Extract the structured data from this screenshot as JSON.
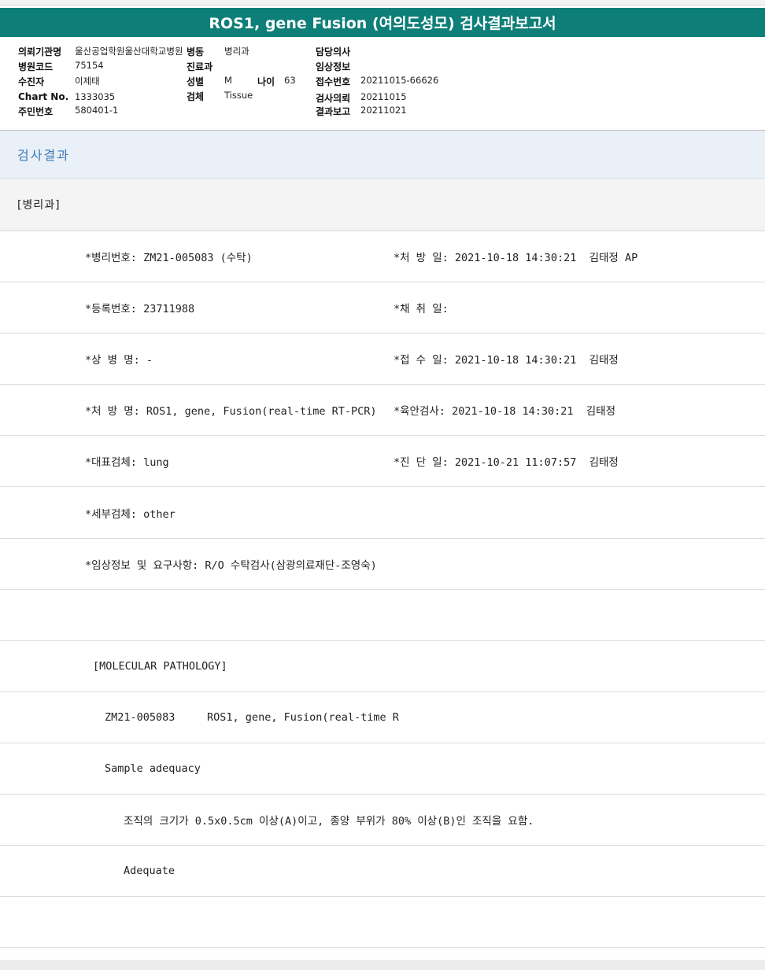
{
  "title": "ROS1, gene Fusion (여의도성모) 검사결과보고서",
  "info": {
    "col1": [
      {
        "label": "의뢰기관명",
        "value": "울산공업학원울산대학교병원"
      },
      {
        "label": "병원코드",
        "value": "75154"
      },
      {
        "label": "수진자",
        "value": "이제태"
      },
      {
        "label": "Chart No.",
        "value": "1333035"
      },
      {
        "label": "주민번호",
        "value": "580401-1"
      }
    ],
    "col2": [
      {
        "label": "병동",
        "value": "병리과"
      },
      {
        "label": "진료과",
        "value": ""
      },
      {
        "label": "성별",
        "value": "M"
      },
      {
        "label": "검체",
        "value": "Tissue"
      }
    ],
    "age": {
      "label": "나이",
      "value": "63"
    },
    "col3": [
      {
        "label": "담당의사",
        "value": ""
      },
      {
        "label": "임상정보",
        "value": ""
      },
      {
        "label": "접수번호",
        "value": "20211015-66626"
      },
      {
        "label": "검사의뢰",
        "value": "20211015"
      },
      {
        "label": "결과보고",
        "value": "20211021"
      }
    ]
  },
  "section_title": "검사결과",
  "department": "[병리과]",
  "rows": [
    {
      "left": "*병리번호: ZM21-005083 (수탁)",
      "right": "*처 방 일: 2021-10-18 14:30:21  김태정 AP"
    },
    {
      "left": "*등록번호: 23711988",
      "right": "*채 취 일:"
    },
    {
      "left": "*상 병 명: -",
      "right": "*접 수 일: 2021-10-18 14:30:21  김태정"
    },
    {
      "left": "*처 방 명: ROS1, gene, Fusion(real-time RT-PCR)",
      "right": "*육안검사: 2021-10-18 14:30:21  김태정"
    },
    {
      "left": "*대표검체: lung",
      "right": "*진 단 일: 2021-10-21 11:07:57  김태정"
    },
    {
      "left": "*세부검체: other",
      "right": ""
    },
    {
      "left": "*임상정보 및 요구사항: R/O 수탁검사(삼광의료재단-조영숙)",
      "right": ""
    },
    {
      "left": "",
      "right": ""
    },
    {
      "left": "[MOLECULAR PATHOLOGY]",
      "right": ""
    },
    {
      "left": "ZM21-005083     ROS1, gene, Fusion(real-time R",
      "right": ""
    },
    {
      "left": "Sample adequacy",
      "right": ""
    },
    {
      "left": "조직의 크기가 0.5x0.5cm 이상(A)이고, 종양 부위가 80% 이상(B)인 조직을 요함.",
      "right": ""
    },
    {
      "left": "Adequate",
      "right": ""
    },
    {
      "left": "",
      "right": ""
    }
  ]
}
